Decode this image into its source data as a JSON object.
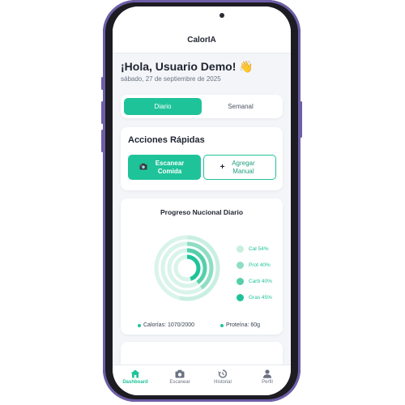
{
  "app": {
    "title": "CalorIA"
  },
  "header": {
    "greeting": "¡Hola, Usuario Demo!",
    "wave_icon": "waving-hand-icon",
    "date": "sábado, 27 de septiembre de 2025"
  },
  "tabs": [
    {
      "label": "Diario",
      "active": true
    },
    {
      "label": "Semanal",
      "active": false
    }
  ],
  "quick_actions": {
    "title": "Acciones Rápidas",
    "scan_label": "Escanear Comida",
    "scan_icon": "camera-icon",
    "add_label": "Agregar Manual",
    "add_icon": "plus-icon"
  },
  "progress": {
    "title": "Progreso Nucional Diario",
    "legend": [
      {
        "label": "Cal 54%",
        "value": 0.54,
        "color": "#c9efe1"
      },
      {
        "label": "Prot 40%",
        "value": 0.4,
        "color": "#8fdec4"
      },
      {
        "label": "Carb 40%",
        "value": 0.4,
        "color": "#55cfa9"
      },
      {
        "label": "Gras 45%",
        "value": 0.45,
        "color": "#1fc39a"
      }
    ],
    "calories_text": "Calorías: 1070/2000",
    "protein_text": "Proteína: 60g"
  },
  "nav": [
    {
      "label": "Dashboard",
      "icon": "home-icon",
      "active": true
    },
    {
      "label": "Escanear",
      "icon": "camera-icon",
      "active": false
    },
    {
      "label": "Historial",
      "icon": "history-icon",
      "active": false
    },
    {
      "label": "Perfil",
      "icon": "user-icon",
      "active": false
    }
  ],
  "colors": {
    "accent": "#1fc39a",
    "frame": "#6e5ea8"
  }
}
